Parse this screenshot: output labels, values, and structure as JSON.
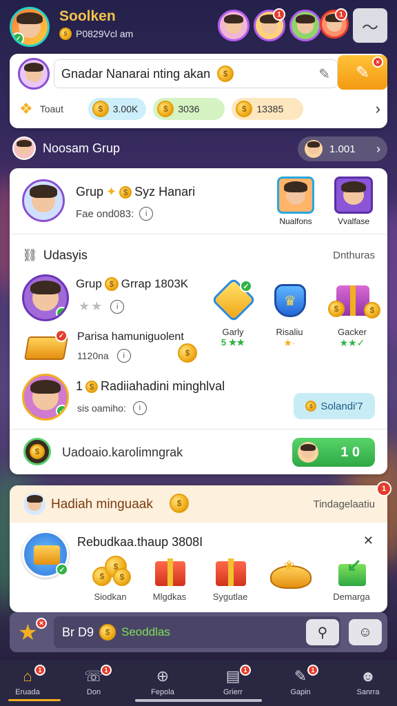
{
  "header": {
    "app_title": "Soolken",
    "subtitle": "P0829Vcl am",
    "notification_badges": [
      "1",
      "1"
    ]
  },
  "search_card": {
    "text": "Gnadar Nanarai nting akan",
    "stats_label": "Toaut",
    "stat_1": "3.00K",
    "stat_2": "3036",
    "stat_3": "13385"
  },
  "group_row": {
    "title": "Noosam Grup",
    "pill": "1.001"
  },
  "group_card": {
    "title": "Grup",
    "title_2": "Syz Hanari",
    "subline": "Fae ond083:",
    "friend_1": "Nualfons",
    "friend_2": "Vvalfase"
  },
  "updates": {
    "title": "Udasyis",
    "right": "Dnthuras",
    "row1_title": "Grup",
    "row1_title_2": "Grrap 1803K",
    "reward_1": "Garly",
    "reward_1_stars": "5",
    "reward_2": "Risaliu",
    "reward_3": "Gacker",
    "row2_title": "Parisa hamuniguolent",
    "row2_sub": "1120na",
    "row3_prefix": "1",
    "row3_title": "Radiiahadini minghlval",
    "row3_sub": "sis oamiho:",
    "row3_button": "Solandi'7",
    "footer_text": "Uadoaio.karolimngrak",
    "footer_pill": "1 0"
  },
  "weekly": {
    "title": "Hadiah minguaak",
    "right": "Tindagelaatiu",
    "badge": "1",
    "row_title": "Rebudkaa.thaup 3808I",
    "items": [
      "Siodkan",
      "Mlgdkas",
      "Sygutlae",
      "",
      "Demarga"
    ]
  },
  "bottom_search": {
    "prefix": "Br D9",
    "text": "Seoddlas"
  },
  "nav": {
    "items": [
      "Eruada",
      "Don",
      "Fepola",
      "Grierr",
      "Gapin",
      "Sanrra"
    ]
  },
  "colors": {
    "accent_orange": "#f5a623",
    "accent_green": "#2fb344",
    "accent_blue": "#29a7e8",
    "badge_red": "#e53b2c"
  }
}
